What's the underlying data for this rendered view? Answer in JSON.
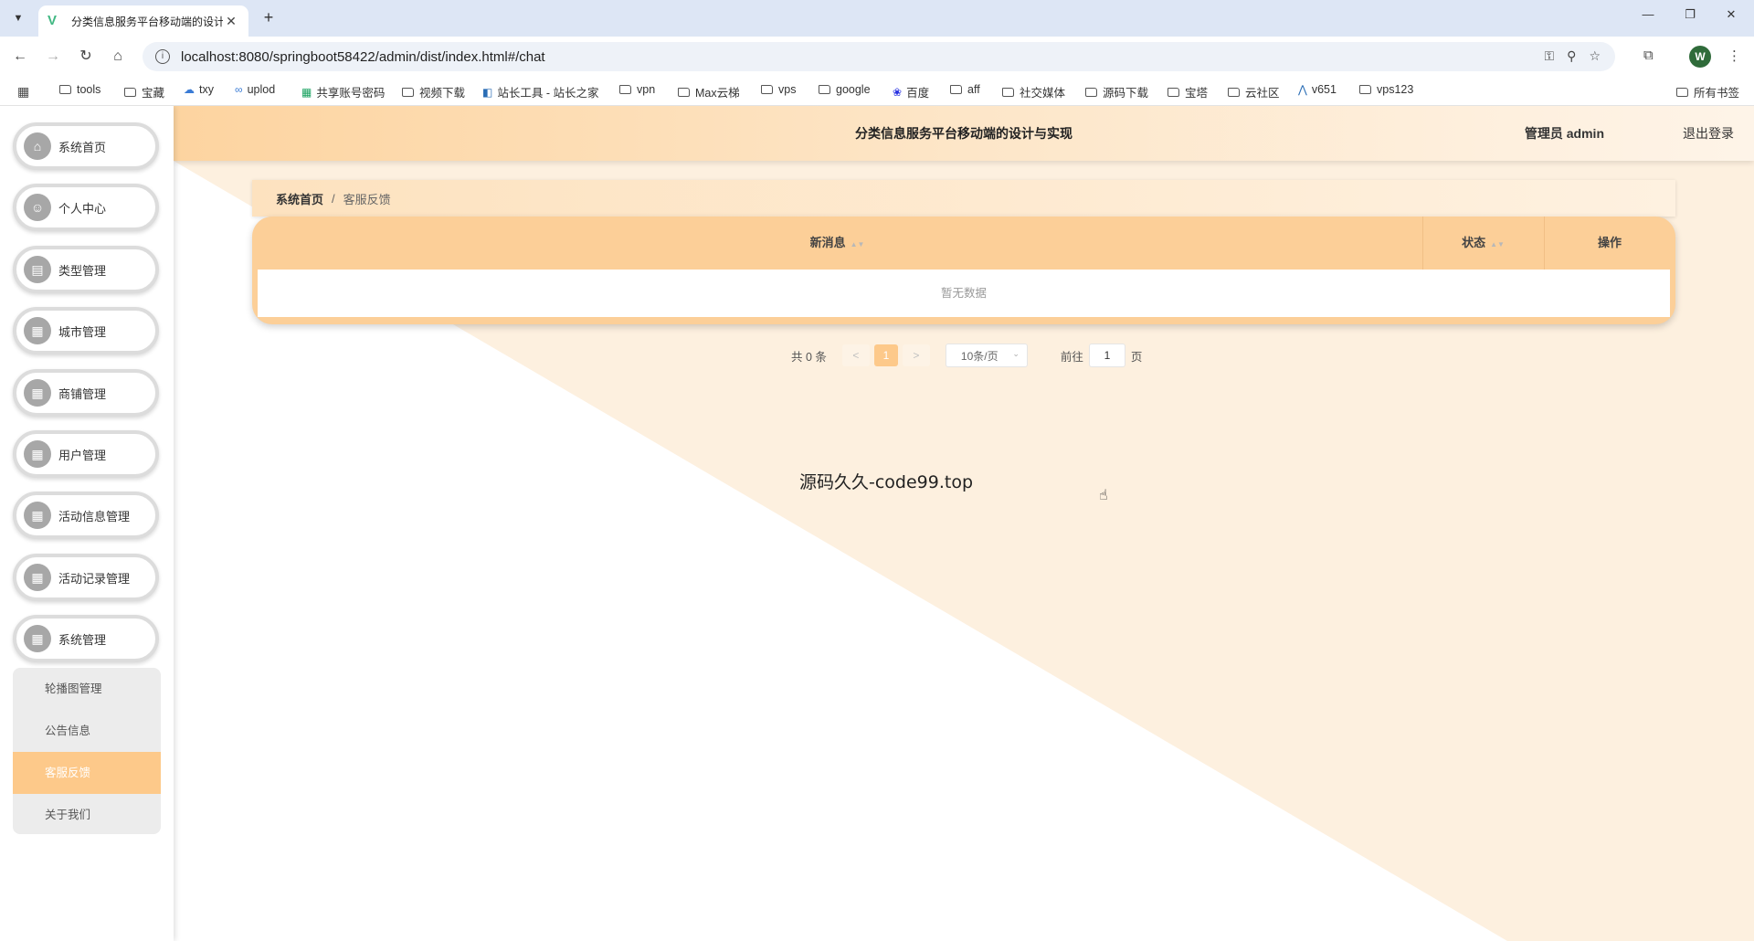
{
  "browser": {
    "tab_title": "分类信息服务平台移动端的设计与实现",
    "url": "localhost:8080/springboot58422/admin/dist/index.html#/chat",
    "profile_initial": "W",
    "bookmarks": [
      "tools",
      "宝藏",
      "txy",
      "uplod",
      "共享账号密码",
      "视频下载",
      "站长工具 - 站长之家",
      "vpn",
      "Max云梯",
      "vps",
      "google",
      "百度",
      "aff",
      "社交媒体",
      "源码下载",
      "宝塔",
      "云社区",
      "v651",
      "vps123"
    ],
    "all_bookmarks": "所有书签"
  },
  "header": {
    "title": "分类信息服务平台移动端的设计与实现",
    "user": "管理员 admin",
    "logout": "退出登录"
  },
  "sidebar": {
    "items": [
      {
        "label": "系统首页",
        "icon": "home-icon"
      },
      {
        "label": "个人中心",
        "icon": "user-icon"
      },
      {
        "label": "类型管理",
        "icon": "clipboard-icon"
      },
      {
        "label": "城市管理",
        "icon": "grid-icon"
      },
      {
        "label": "商铺管理",
        "icon": "grid-icon"
      },
      {
        "label": "用户管理",
        "icon": "grid-icon"
      },
      {
        "label": "活动信息管理",
        "icon": "grid-icon"
      },
      {
        "label": "活动记录管理",
        "icon": "grid-icon"
      },
      {
        "label": "系统管理",
        "icon": "grid-icon"
      }
    ],
    "submenu": [
      "轮播图管理",
      "公告信息",
      "客服反馈",
      "关于我们"
    ]
  },
  "breadcrumb": {
    "home": "系统首页",
    "separator": "/",
    "current": "客服反馈"
  },
  "table": {
    "columns": [
      "新消息",
      "状态",
      "操作"
    ],
    "empty_text": "暂无数据"
  },
  "pagination": {
    "total": "共 0 条",
    "prev": "<",
    "page": "1",
    "next": ">",
    "page_size": "10条/页",
    "goto_label": "前往",
    "goto_value": "1",
    "page_suffix": "页"
  },
  "watermark": "源码久久-code99.top",
  "colors": {
    "accent": "#fdc98a",
    "header_start": "#fdd4a0",
    "background_triangle": "#fdf0df"
  }
}
